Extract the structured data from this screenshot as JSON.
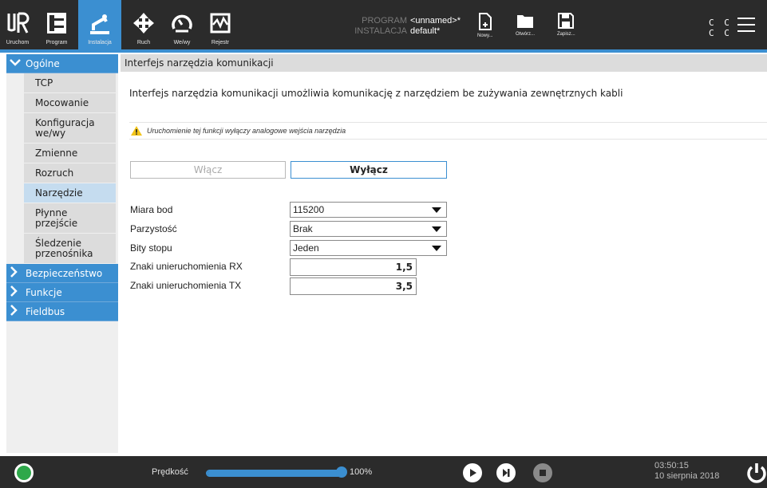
{
  "topbar": {
    "tabs": [
      {
        "label": "Uruchom",
        "icon": "ur-logo-icon"
      },
      {
        "label": "Program",
        "icon": "program-tree-icon"
      },
      {
        "label": "Instalacja",
        "icon": "installation-arm-icon"
      },
      {
        "label": "Ruch",
        "icon": "move-arrows-icon"
      },
      {
        "label": "We/wy",
        "icon": "io-gauge-icon"
      },
      {
        "label": "Rejestr",
        "icon": "log-chart-icon"
      }
    ],
    "program_key": "PROGRAM",
    "program_value": "<unnamed>*",
    "installation_key": "INSTALACJA",
    "installation_value": "default*",
    "new_label": "Nowy...",
    "open_label": "Otwórz...",
    "save_label": "Zapisz...",
    "cc_line1": "C C",
    "cc_line2": "C C"
  },
  "nav": {
    "general": "Ogólne",
    "items": [
      "TCP",
      "Mocowanie",
      "Konfiguracja we/wy",
      "Zmienne",
      "Rozruch",
      "Narzędzie",
      "Płynne przejście",
      "Śledzenie przenośnika"
    ],
    "item_lines": [
      [
        "TCP"
      ],
      [
        "Mocowanie"
      ],
      [
        "Konfiguracja",
        "we/wy"
      ],
      [
        "Zmienne"
      ],
      [
        "Rozruch"
      ],
      [
        "Narzędzie"
      ],
      [
        "Płynne",
        "przejście"
      ],
      [
        "Śledzenie",
        "przenośnika"
      ]
    ],
    "groups": [
      "Bezpieczeństwo",
      "Funkcje",
      "Fieldbus"
    ]
  },
  "main": {
    "header": "Interfejs narzędzia komunikacji",
    "description": "Interfejs narzędzia komunikacji umożliwia komunikację z narzędziem be zużywania zewnętrznych kabli",
    "warning": "Uruchomienie tej funkcji wyłączy analogowe wejścia narzędzia",
    "enable_label": "Włącz",
    "disable_label": "Wyłącz",
    "fields": {
      "baud_label": "Miara bod",
      "baud_value": "115200",
      "parity_label": "Parzystość",
      "parity_value": "Brak",
      "stopbits_label": "Bity stopu",
      "stopbits_value": "Jeden",
      "rx_label": "Znaki unieruchomienia RX",
      "rx_value": "1,5",
      "tx_label": "Znaki unieruchomienia TX",
      "tx_value": "3,5"
    }
  },
  "bottombar": {
    "speed_label": "Prędkość",
    "speed_value": "100%",
    "speed_fraction": 1.0,
    "time": "03:50:15",
    "date": "10 sierpnia 2018"
  },
  "colors": {
    "accent": "#3b8fd1",
    "dark": "#2b2b2b",
    "status_ok": "#2ea84a"
  }
}
